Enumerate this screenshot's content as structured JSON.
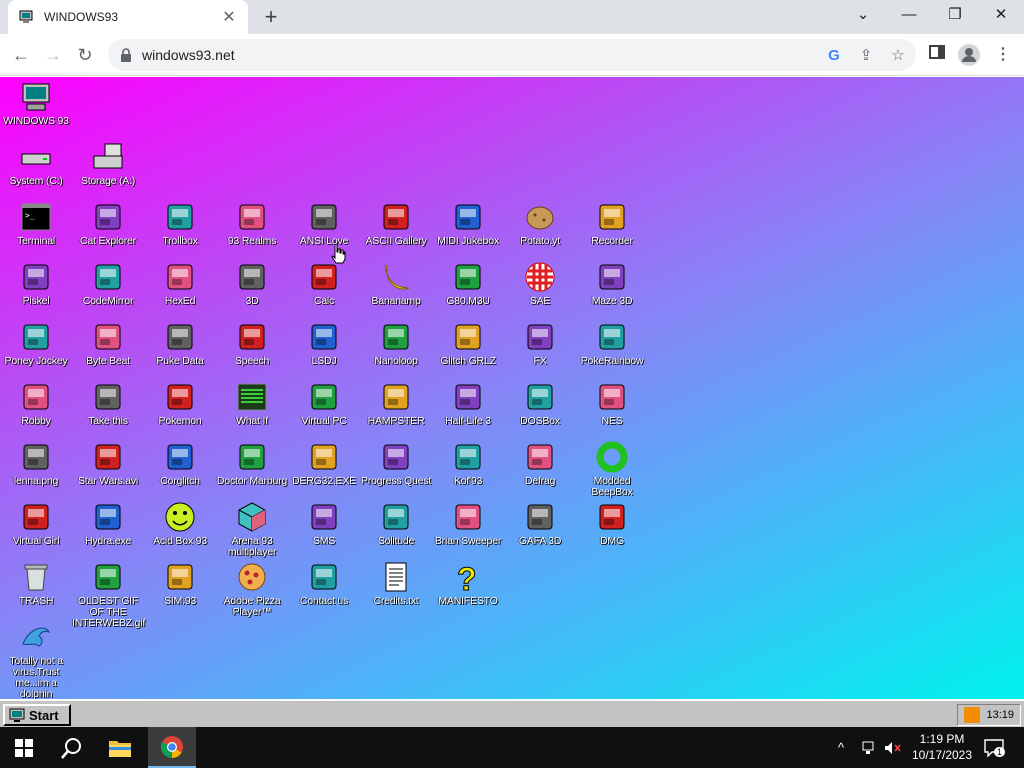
{
  "browser": {
    "tab_title": "WINDOWS93",
    "url": "windows93.net",
    "tab_close": "✕",
    "new_tab": "+",
    "win_minimize": "—",
    "win_restore": "❐",
    "win_close": "✕",
    "back": "←",
    "forward": "→",
    "reload": "↻"
  },
  "desktop": {
    "icons": [
      {
        "label": "WINDOWS 93",
        "icon": "computer-icon",
        "col": 0,
        "row": 0
      },
      {
        "label": "System (C:)",
        "icon": "drive-icon",
        "col": 0,
        "row": 1
      },
      {
        "label": "Storage (A:)",
        "icon": "floppy-drive-icon",
        "col": 1,
        "row": 1
      },
      {
        "label": "Terminal",
        "icon": "terminal-icon",
        "col": 0,
        "row": 2
      },
      {
        "label": "Cat Explorer",
        "icon": "cat-globe-icon",
        "col": 1,
        "row": 2
      },
      {
        "label": "Trollbox",
        "icon": "chat-bubble-icon",
        "col": 2,
        "row": 2
      },
      {
        "label": "93 Realms",
        "icon": "knight-icon",
        "col": 3,
        "row": 2
      },
      {
        "label": "ANSI Love",
        "icon": "ansi-letter-icon",
        "col": 4,
        "row": 2
      },
      {
        "label": "ASCII Gallery",
        "icon": "numbers-icon",
        "col": 5,
        "row": 2
      },
      {
        "label": "MIDI Jukebox",
        "icon": "piano-icon",
        "col": 6,
        "row": 2
      },
      {
        "label": "Potato.yt",
        "icon": "potato-icon",
        "col": 7,
        "row": 2
      },
      {
        "label": "Recorder",
        "icon": "microphone-icon",
        "col": 8,
        "row": 2
      },
      {
        "label": "Piskel",
        "icon": "palette-icon",
        "col": 0,
        "row": 3
      },
      {
        "label": "CodeMirror",
        "icon": "codemirror-icon",
        "col": 1,
        "row": 3
      },
      {
        "label": "HexEd",
        "icon": "hex-cube-icon",
        "col": 2,
        "row": 3
      },
      {
        "label": "3D",
        "icon": "teapot-icon",
        "col": 3,
        "row": 3
      },
      {
        "label": "Calc",
        "icon": "calculator-icon",
        "col": 4,
        "row": 3
      },
      {
        "label": "Bananamp",
        "icon": "banana-icon",
        "col": 5,
        "row": 3
      },
      {
        "label": "G80.M3U",
        "icon": "speaker-file-icon",
        "col": 6,
        "row": 3
      },
      {
        "label": "SAE",
        "icon": "amiga-ball-icon",
        "col": 7,
        "row": 3
      },
      {
        "label": "Maze 3D",
        "icon": "maze-icon",
        "col": 8,
        "row": 3
      },
      {
        "label": "Poney Jockey",
        "icon": "pony-icon",
        "col": 0,
        "row": 4
      },
      {
        "label": "Byte Beat",
        "icon": "bytebeat-icon",
        "col": 1,
        "row": 4
      },
      {
        "label": "Puke Data",
        "icon": "pd-icon",
        "col": 2,
        "row": 4
      },
      {
        "label": "Speech",
        "icon": "face-icon",
        "col": 3,
        "row": 4
      },
      {
        "label": "LSDJ",
        "icon": "gameboy-icon",
        "col": 4,
        "row": 4
      },
      {
        "label": "Nanoloop",
        "icon": "nanoloop-icon",
        "col": 5,
        "row": 4
      },
      {
        "label": "Glitch GRLZ",
        "icon": "lips-icon",
        "col": 6,
        "row": 4
      },
      {
        "label": "FX",
        "icon": "atom-icon",
        "col": 7,
        "row": 4
      },
      {
        "label": "PokeRainbow",
        "icon": "pokerainbow-icon",
        "col": 8,
        "row": 4
      },
      {
        "label": "Robby",
        "icon": "stick-figure-icon",
        "col": 0,
        "row": 5
      },
      {
        "label": "Take this",
        "icon": "character-icon",
        "col": 1,
        "row": 5
      },
      {
        "label": "Pokemon",
        "icon": "pokemon-icon",
        "col": 2,
        "row": 5
      },
      {
        "label": "What If",
        "icon": "terminal-green-icon",
        "col": 3,
        "row": 5
      },
      {
        "label": "Virtual PC",
        "icon": "window-icon",
        "col": 4,
        "row": 5
      },
      {
        "label": "HAMPSTER",
        "icon": "owl-icon",
        "col": 5,
        "row": 5
      },
      {
        "label": "Half-Life 3",
        "icon": "half-life-icon",
        "col": 6,
        "row": 5
      },
      {
        "label": "DOSBox",
        "icon": "dosbox-icon",
        "col": 7,
        "row": 5
      },
      {
        "label": "NES",
        "icon": "nes-icon",
        "col": 8,
        "row": 5
      },
      {
        "label": "lenna.png",
        "icon": "image-file-icon",
        "col": 0,
        "row": 6
      },
      {
        "label": "Star Wars.avi",
        "icon": "yoda-icon",
        "col": 1,
        "row": 6
      },
      {
        "label": "Corglitch",
        "icon": "corgi-icon",
        "col": 2,
        "row": 6
      },
      {
        "label": "Doctor Marburg",
        "icon": "doctor-icon",
        "col": 3,
        "row": 6
      },
      {
        "label": "DERG32.EXE",
        "icon": "robot-monitor-icon",
        "col": 4,
        "row": 6
      },
      {
        "label": "Progress Quest",
        "icon": "crossed-swords-icon",
        "col": 5,
        "row": 6
      },
      {
        "label": "Kof'93",
        "icon": "fighter-icon",
        "col": 6,
        "row": 6
      },
      {
        "label": "Defrag",
        "icon": "defrag-icon",
        "col": 7,
        "row": 6
      },
      {
        "label": "Modded BeepBox",
        "icon": "green-ring-icon",
        "col": 8,
        "row": 6
      },
      {
        "label": "Virtual Girl",
        "icon": "girl-face-icon",
        "col": 0,
        "row": 7
      },
      {
        "label": "Hydra.exe",
        "icon": "hydra-icon",
        "col": 1,
        "row": 7
      },
      {
        "label": "Acid Box 93",
        "icon": "smiley-icon",
        "col": 2,
        "row": 7
      },
      {
        "label": "Arena 93 multiplayer",
        "icon": "cube-icon",
        "col": 3,
        "row": 7
      },
      {
        "label": "SMS",
        "icon": "sms-console-icon",
        "col": 4,
        "row": 7
      },
      {
        "label": "Solitude",
        "icon": "bottle-icon",
        "col": 5,
        "row": 7
      },
      {
        "label": "Brian Sweeper",
        "icon": "mine-icon",
        "col": 6,
        "row": 7
      },
      {
        "label": "GAFA 3D",
        "icon": "doom-face-icon",
        "col": 7,
        "row": 7
      },
      {
        "label": "DMG",
        "icon": "dmg-icon",
        "col": 8,
        "row": 7
      },
      {
        "label": "TRASH",
        "icon": "trash-icon",
        "col": 0,
        "row": 8
      },
      {
        "label": "OLDEST GIF OF THE INTERWEBZ.gif",
        "icon": "gif-file-icon",
        "col": 1,
        "row": 8
      },
      {
        "label": "SIM.93",
        "icon": "book-icon",
        "col": 2,
        "row": 8
      },
      {
        "label": "Adobe Pizza Player™",
        "icon": "pizza-icon",
        "col": 3,
        "row": 8
      },
      {
        "label": "Contact us",
        "icon": "contact-icon",
        "col": 4,
        "row": 8
      },
      {
        "label": "Credits.txt",
        "icon": "text-file-icon",
        "col": 5,
        "row": 8
      },
      {
        "label": "MANIFESTO",
        "icon": "question-mark-icon",
        "col": 6,
        "row": 8
      },
      {
        "label": "Totally not a virus.Trust me...im a dolphin",
        "icon": "dolphin-icon",
        "col": 0,
        "row": 9
      }
    ]
  },
  "w93_taskbar": {
    "start_label": "Start",
    "time": "13:19"
  },
  "win_taskbar": {
    "time": "1:19 PM",
    "date": "10/17/2023",
    "notification_count": "1"
  },
  "colors": {
    "gradient_start": "#ff00ff",
    "gradient_end": "#00f2ee",
    "w93_gray": "#c3c3c3"
  }
}
